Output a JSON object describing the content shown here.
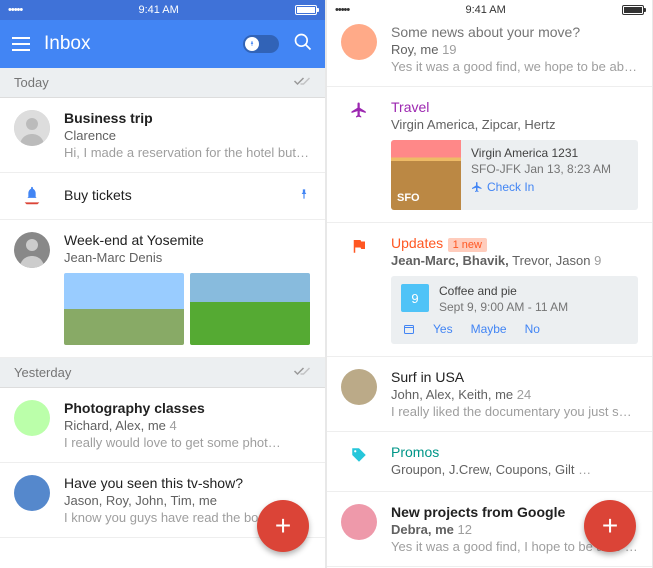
{
  "status": {
    "time": "9:41 AM"
  },
  "header": {
    "title": "Inbox"
  },
  "sections": {
    "today": "Today",
    "yesterday": "Yesterday"
  },
  "screen1": {
    "items": [
      {
        "title": "Business trip",
        "sender": "Clarence",
        "preview": "Hi, I made a reservation for the hotel but it…"
      },
      {
        "title": "Buy tickets"
      },
      {
        "title": "Week-end at Yosemite",
        "sender": "Jean-Marc Denis"
      },
      {
        "title": "Photography classes",
        "senders": "Richard, Alex, me",
        "count": "4",
        "preview": "I really would love to get some phot…"
      },
      {
        "title": "Have you seen this tv-show?",
        "senders": "Jason, Roy, John, Tim, me",
        "preview": "I know you guys have read the book an…"
      }
    ]
  },
  "screen2": {
    "items": [
      {
        "title": "Some news about your move?",
        "senders": "Roy, me",
        "count": "19",
        "preview": "Yes it was a good find, we hope to be able …"
      },
      {
        "label": "Travel",
        "senders": "Virgin America, Zipcar, Hertz",
        "flight": {
          "name": "Virgin America 1231",
          "detail": "SFO-JFK Jan 13, 8:23 AM",
          "checkin": "Check In",
          "origin": "SFO"
        }
      },
      {
        "label": "Updates",
        "badge": "1 new",
        "sendersHtmlBold": "Jean-Marc, Bhavik,",
        "sendersRest": " Trevor, Jason",
        "count": "9",
        "event": {
          "title": "Coffee and pie",
          "time": "Sept 9, 9:00 AM - 11 AM",
          "day": "9",
          "yes": "Yes",
          "maybe": "Maybe",
          "no": "No"
        }
      },
      {
        "title": "Surf in USA",
        "senders": "John, Alex, Keith, me",
        "count": "24",
        "preview": "I really liked the documentary you just sent…"
      },
      {
        "label": "Promos",
        "senders": "Groupon, J.Crew, Coupons, Gilt",
        "truncated": "…"
      },
      {
        "title": "New projects from Google",
        "senders": "Debra, me",
        "count": "12",
        "preview": "Yes it was a good find, I hope to be able …"
      }
    ]
  }
}
